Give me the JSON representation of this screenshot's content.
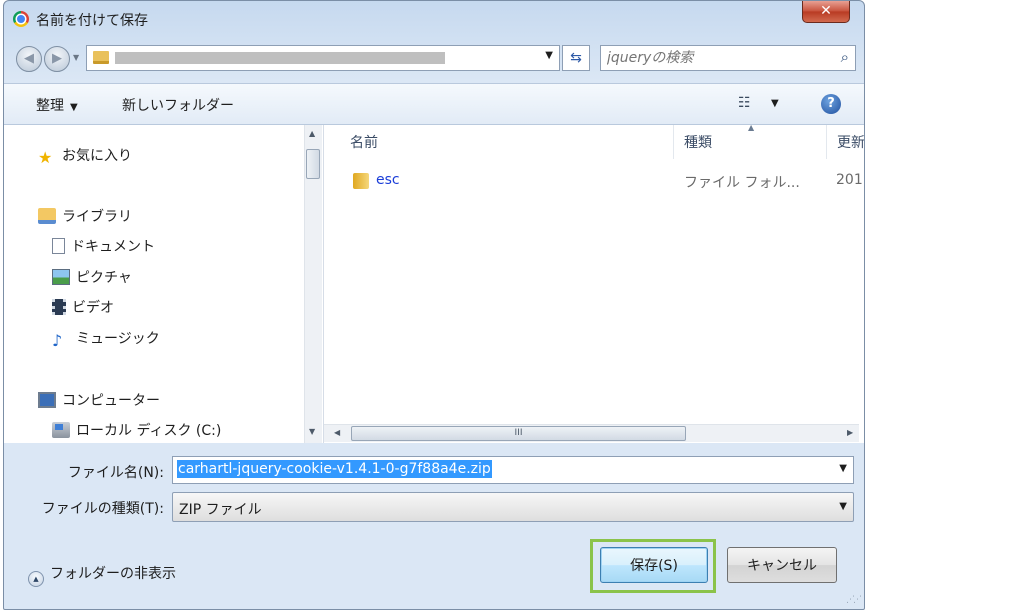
{
  "window": {
    "title": "名前を付けて保存",
    "close_glyph": "✕"
  },
  "navigation": {
    "back_glyph": "◀",
    "forward_glyph": "▶",
    "address_path": "",
    "search_placeholder": "jqueryの検索"
  },
  "toolbar": {
    "organize_label": "整理",
    "new_folder_label": "新しいフォルダー"
  },
  "tree": {
    "favorites": "お気に入り",
    "libraries": "ライブラリ",
    "documents": "ドキュメント",
    "pictures": "ピクチャ",
    "videos": "ビデオ",
    "music": "ミュージック",
    "computer": "コンピューター",
    "local_disk": "ローカル ディスク (C:)"
  },
  "file_list": {
    "columns": {
      "name": "名前",
      "type": "種類",
      "date": "更新"
    },
    "rows": [
      {
        "name": "esc",
        "type": "ファイル フォル...",
        "date": "201"
      }
    ]
  },
  "form": {
    "filename_label": "ファイル名(N):",
    "filename_value": "carhartl-jquery-cookie-v1.4.1-0-g7f88a4e.zip",
    "filetype_label": "ファイルの種類(T):",
    "filetype_value": "ZIP ファイル"
  },
  "footer": {
    "hide_folders_label": "フォルダーの非表示",
    "save_label": "保存(S)",
    "cancel_label": "キャンセル"
  },
  "colors": {
    "highlight_border": "#8bc34a",
    "selection": "#3399ff",
    "link_text": "#1b3ed8"
  }
}
